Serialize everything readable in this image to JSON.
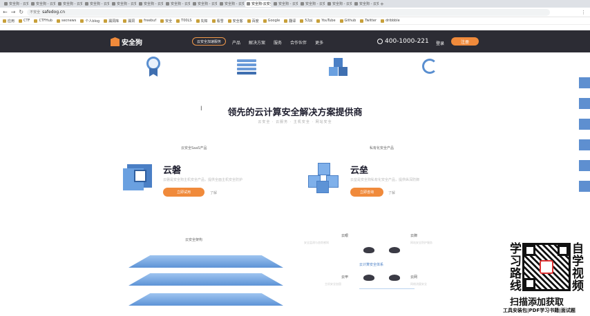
{
  "browser": {
    "tabs": [
      {
        "label": "安全狗 - 云安全",
        "active": false
      },
      {
        "label": "安全狗 - 云安全",
        "active": false
      },
      {
        "label": "安全狗 - 云安全",
        "active": false
      },
      {
        "label": "安全狗 - 云安全",
        "active": false
      },
      {
        "label": "安全狗 - 云安全",
        "active": false
      },
      {
        "label": "安全狗 - 云安全",
        "active": false
      },
      {
        "label": "安全狗 - 云安全",
        "active": false
      },
      {
        "label": "安全狗 - 云安全",
        "active": false
      },
      {
        "label": "安全狗 - 云安全",
        "active": false
      },
      {
        "label": "安全狗-云安全服务...",
        "active": true
      },
      {
        "label": "安全狗 - 云安全",
        "active": false
      },
      {
        "label": "安全狗 - 云安全",
        "active": false
      },
      {
        "label": "安全狗 - 云安全",
        "active": false
      },
      {
        "label": "安全狗 - 云安全",
        "active": false
      }
    ],
    "warning": "不安全",
    "url": "safedog.cn",
    "bookmarks": [
      "应用",
      "CTF",
      "CTFHub",
      "secnews",
      "个人blog",
      "漏洞库",
      "漏洞",
      "freebuf",
      "安全",
      "T00LS",
      "先知",
      "看雪",
      "安全客",
      "百度",
      "Google",
      "翻译",
      "52pj",
      "YouTube",
      "Github",
      "Twitter",
      "dribbble"
    ]
  },
  "site": {
    "logo": "安全狗",
    "pill": "云安全加速服务",
    "menu": [
      "产品",
      "解决方案",
      "服务",
      "合作伙伴",
      "更多"
    ],
    "phone": "400-1000-221",
    "login": "登录",
    "register": "注册"
  },
  "hero": {
    "cursor": "I",
    "headline": "领先的云计算安全解决方案提供商",
    "subline": "云安全 · 云服务 · 主机安全 · 网站安全"
  },
  "products": [
    {
      "category": "云安全SaaS产品",
      "name": "云磐",
      "desc": "云磐是安全狗主机安全产品，提供全面主机安全防护",
      "primary": "立即试用",
      "secondary": "了解"
    },
    {
      "category": "私有化安全产品",
      "name": "云垒",
      "desc": "云垒是安全狗私有化安全产品，提供纵深防御",
      "primary": "立即咨询",
      "secondary": "了解"
    }
  ],
  "architecture": {
    "title": "云安全架构",
    "center": "云计算安全体系",
    "nodes": [
      {
        "label": "云眼",
        "desc": "安全监测与态势感知"
      },
      {
        "label": "云御",
        "desc": "网站安全防护服务"
      },
      {
        "label": "云甲",
        "desc": "主机安全加固"
      },
      {
        "label": "云网",
        "desc": "网络流量安全"
      }
    ]
  },
  "qr": {
    "left": "学习路线",
    "right": "自学视频",
    "cta": "扫描添加获取",
    "footer": "工具安装包|PDF学习书籍|面试题"
  },
  "colors": {
    "nav_bg": "#2c2c34",
    "accent": "#f08a3b",
    "brand_blue": "#4a7fc5"
  }
}
